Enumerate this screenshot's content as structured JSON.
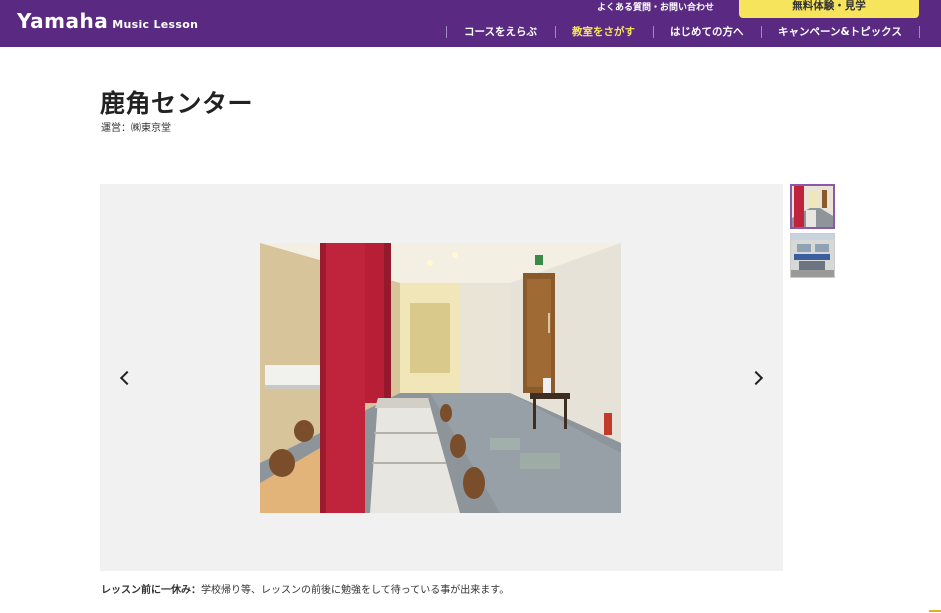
{
  "header": {
    "logo_main": "Yamaha",
    "logo_sub": "Music Lesson",
    "faq_link": "よくある質問・お問い合わせ",
    "trial_button": "無料体験・見学",
    "nav": [
      {
        "label": "コースをえらぶ",
        "active": false
      },
      {
        "label": "教室をさがす",
        "active": true
      },
      {
        "label": "はじめての方へ",
        "active": false
      },
      {
        "label": "キャンペーン&トピックス",
        "active": false
      }
    ]
  },
  "page": {
    "title": "鹿角センター",
    "operator": "運営：㈱東京堂"
  },
  "gallery": {
    "caption_label": "レッスン前に一休み：",
    "caption_text": "学校帰り等、レッスンの前後に勉強をして待っている事が出来ます。"
  },
  "colors": {
    "header_bg": "#5a2a82",
    "nav_active": "#f6e45c",
    "trial_button_bg": "#f6e45c",
    "gallery_bg": "#f1f1f1"
  }
}
